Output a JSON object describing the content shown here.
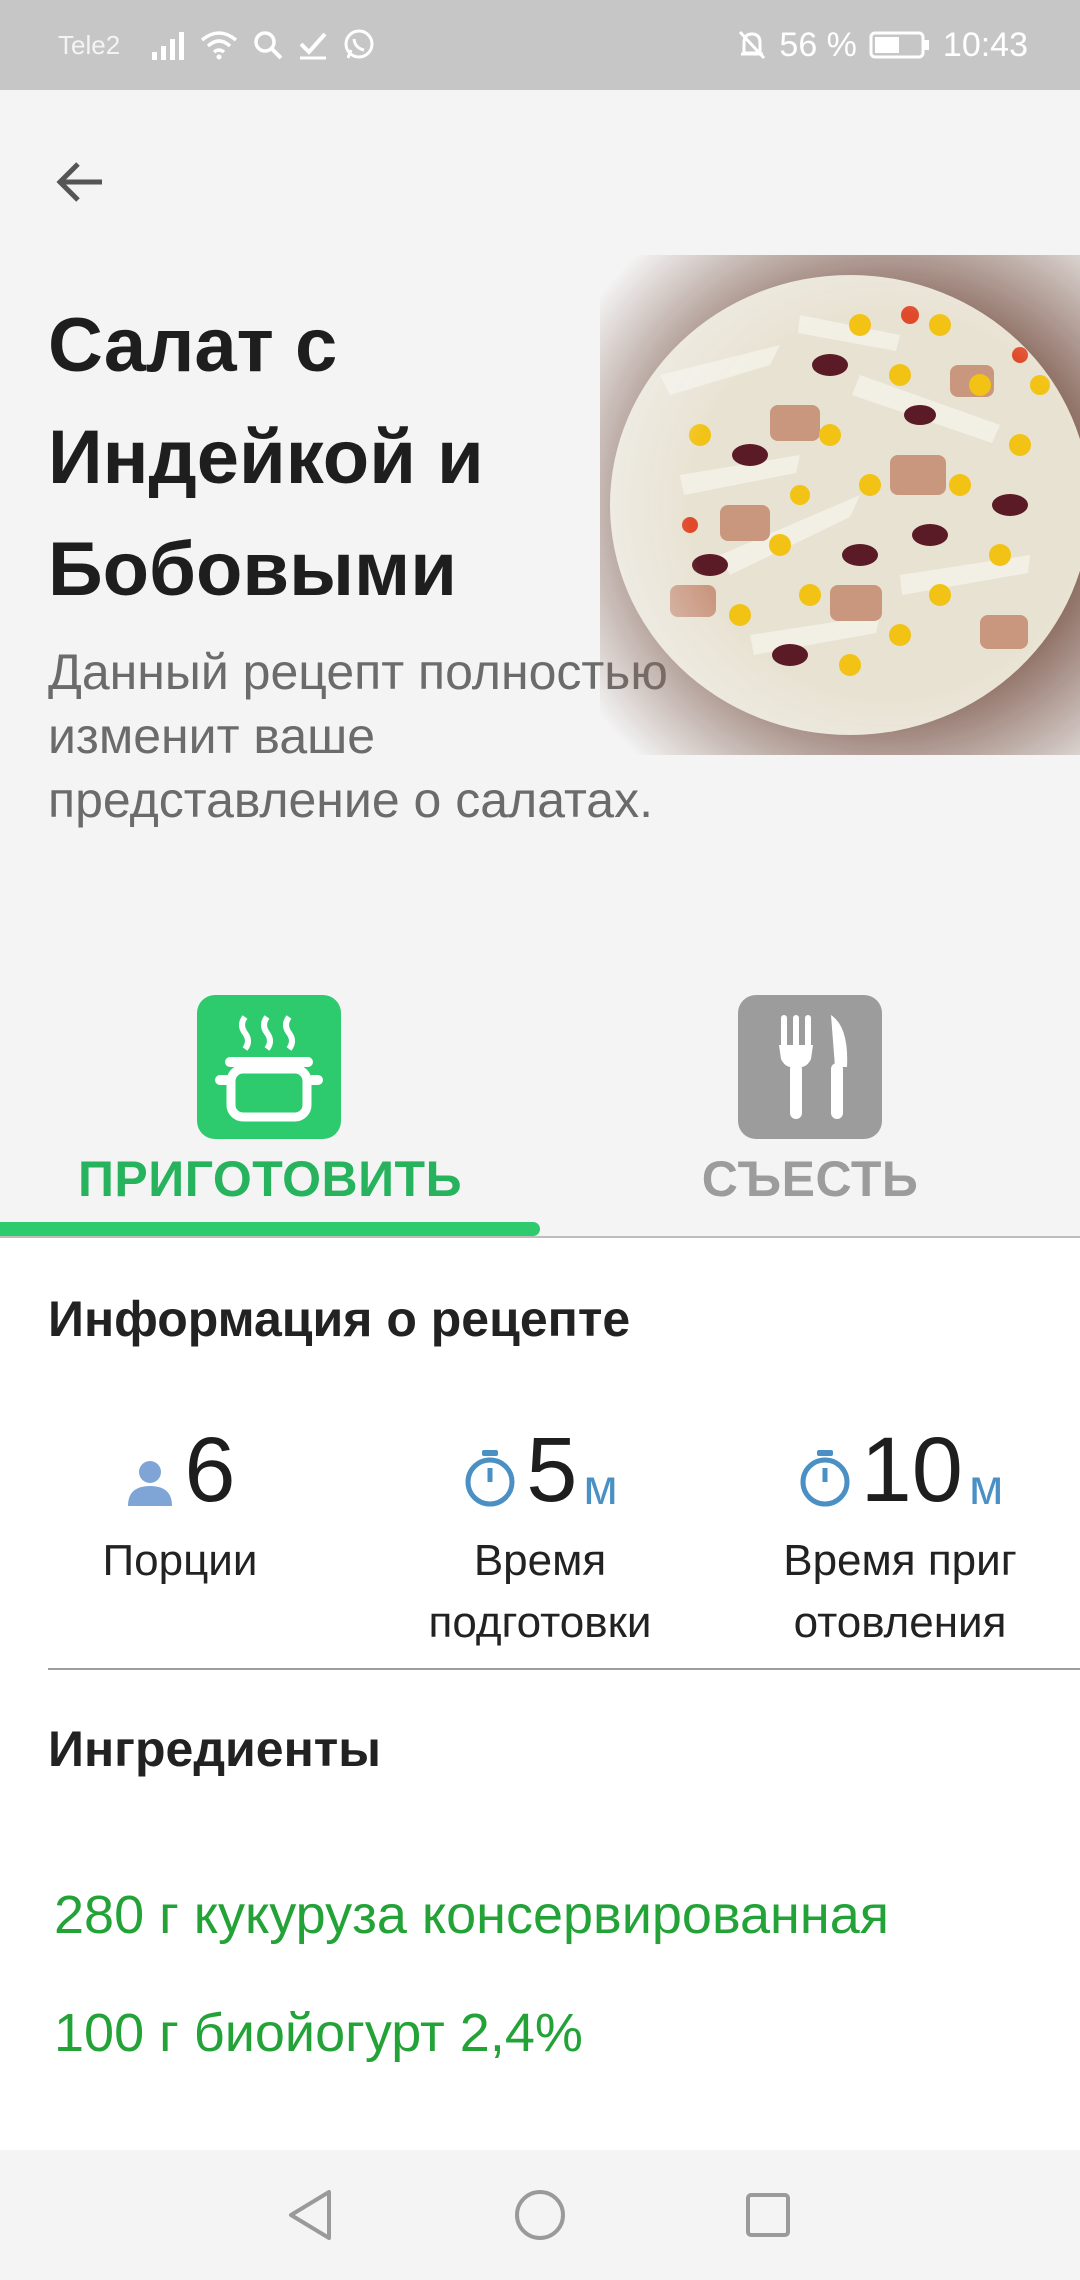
{
  "status_bar": {
    "carrier": "Tele2",
    "battery_percent": "56 %",
    "time": "10:43",
    "icons": [
      "signal-icon",
      "wifi-icon",
      "search-icon",
      "check-icon",
      "whatsapp-icon",
      "bell-off-icon",
      "battery-icon"
    ]
  },
  "recipe": {
    "title": "Салат с Индейкой и Бобовыми",
    "description": "Данный рецепт полностью изменит ваше представление о салатах."
  },
  "tabs": [
    {
      "label": "ПРИГОТОВИТЬ",
      "icon": "pot-icon",
      "active": true
    },
    {
      "label": "СЪЕСТЬ",
      "icon": "fork-knife-icon",
      "active": false
    }
  ],
  "info": {
    "section_title": "Информация о рецепте",
    "stats": [
      {
        "value": "6",
        "unit": "",
        "label": "Порции",
        "icon": "person-icon"
      },
      {
        "value": "5",
        "unit": "м",
        "label": "Время подготовки",
        "icon": "timer-icon"
      },
      {
        "value": "10",
        "unit": "м",
        "label": "Время приг отовления",
        "icon": "timer-icon"
      }
    ]
  },
  "ingredients": {
    "section_title": "Ингредиенты",
    "items": [
      "280 г кукуруза консервированная",
      "100 г биойогурт 2,4%"
    ]
  },
  "colors": {
    "accent_green": "#2dcb6e",
    "ingredient_green": "#23a337",
    "inactive_gray": "#9c9c9c",
    "unit_blue": "#4a90c4"
  }
}
